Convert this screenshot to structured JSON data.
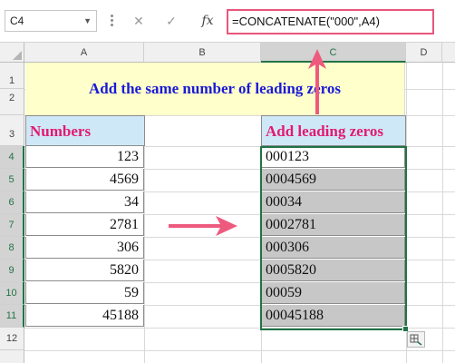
{
  "formula_bar": {
    "name_box": "C4",
    "cancel_symbol": "✕",
    "enter_symbol": "✓",
    "fx_label": "fx",
    "formula": "=CONCATENATE(\"000\",A4)"
  },
  "columns": [
    "A",
    "B",
    "C",
    "D"
  ],
  "rows": [
    "1",
    "2",
    "3",
    "4",
    "5",
    "6",
    "7",
    "8",
    "9",
    "10",
    "11",
    "12"
  ],
  "title": "Add the same number of leading zeros",
  "numbers_header": "Numbers",
  "result_header": "Add leading zeros",
  "numbers": [
    "123",
    "4569",
    "34",
    "2781",
    "306",
    "5820",
    "59",
    "45188"
  ],
  "results": [
    "000123",
    "0004569",
    "00034",
    "0002781",
    "000306",
    "0005820",
    "00059",
    "00045188"
  ],
  "colors": {
    "accent_arrow": "#ee5a7e",
    "title_text": "#1a1ad6",
    "header_text": "#e21a73",
    "header_bg": "#cfe8f7",
    "title_bg": "#ffffcc",
    "selection": "#217346"
  },
  "icons": {
    "name_box_dropdown": "chevron-down-icon",
    "quick_analysis": "quick-analysis-icon"
  }
}
